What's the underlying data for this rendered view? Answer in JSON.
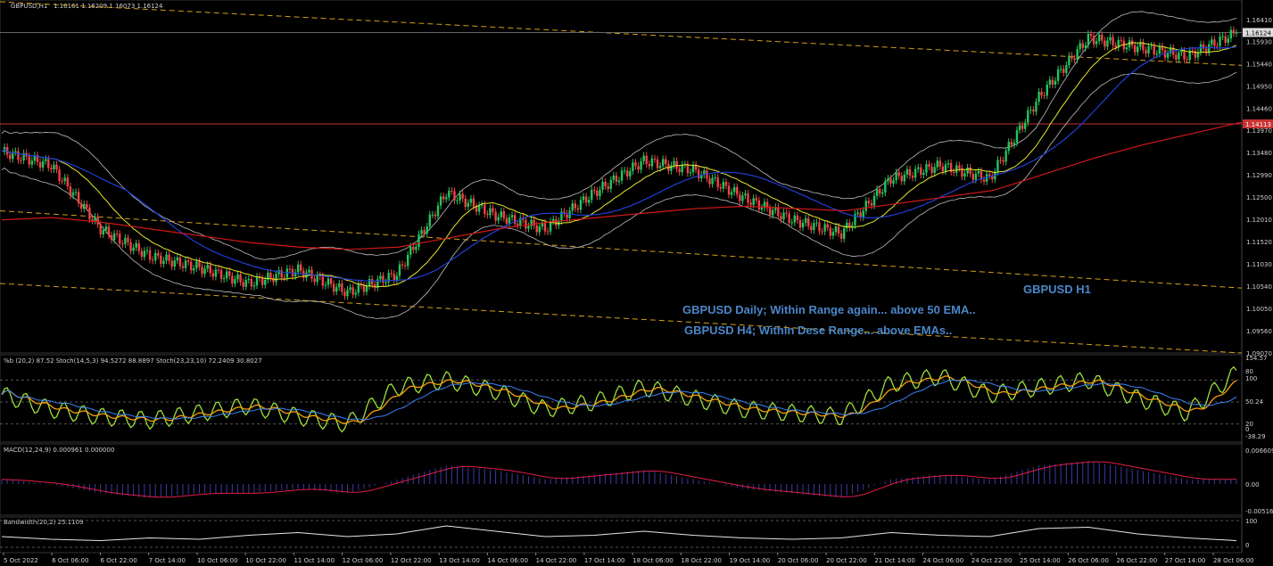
{
  "window": {
    "symbol_header": "GBPUSD,H1",
    "ohlc_header": "1.16161 1.16209 1.16073 1.16124"
  },
  "price_axis": {
    "ticks": [
      "1.16410",
      "1.15930",
      "1.15440",
      "1.14950",
      "1.14460",
      "1.13970",
      "1.13480",
      "1.12990",
      "1.12500",
      "1.12010",
      "1.11520",
      "1.11030",
      "1.10540",
      "1.10050",
      "1.09560",
      "1.09070"
    ],
    "current_price": "1.16124",
    "level_price": "1.14113"
  },
  "annotations": {
    "pair_tf": "GBPUSD H1",
    "daily_note": "GBPUSD Daily; Within Range again... above 50 EMA..",
    "h4_note": "GBPUSD H4;  Within Dese Range... above EMAs.."
  },
  "indicators": {
    "stoch": {
      "header": "%b (20,2) 87.52  Stoch(14,5,3) 94.5272 88.8897  Stoch(23,23,10) 72.2409 30.8027",
      "ticks": [
        "154.57",
        "80",
        "100",
        "50.24",
        "20",
        "0",
        "-38.29"
      ]
    },
    "macd": {
      "header": "MACD(12,24,9) 0.000961 0.000000",
      "ticks": [
        "0.006609",
        "0.00",
        "-0.005161"
      ]
    },
    "bandwidth": {
      "header": "Bandwidth(20,2) 25.1109",
      "ticks": [
        "100",
        "0"
      ]
    }
  },
  "time_axis": {
    "labels": [
      "5 Oct 2022",
      "6 Oct 06:00",
      "6 Oct 22:00",
      "7 Oct 14:00",
      "10 Oct 06:00",
      "10 Oct 22:00",
      "11 Oct 14:00",
      "12 Oct 06:00",
      "12 Oct 22:00",
      "13 Oct 14:00",
      "14 Oct 06:00",
      "14 Oct 22:00",
      "17 Oct 14:00",
      "18 Oct 06:00",
      "18 Oct 22:00",
      "19 Oct 14:00",
      "20 Oct 06:00",
      "20 Oct 22:00",
      "21 Oct 14:00",
      "24 Oct 06:00",
      "24 Oct 22:00",
      "25 Oct 14:00",
      "26 Oct 06:00",
      "26 Oct 22:00",
      "27 Oct 14:00",
      "28 Oct 06:00"
    ]
  },
  "colors": {
    "background": "#000000",
    "bull_candle": "#22c55e",
    "bear_candle": "#ef4444",
    "ema_fast": "#e6e62d",
    "ema_mid": "#1f3fd6",
    "ema_slow": "#d01818",
    "bollinger": "#bdbdbd",
    "channel": "#d4a017",
    "horizontal_level": "#c83232",
    "stoch_main": "#9be03a",
    "stoch_slow": "#f59e0b",
    "pctb": "#3b82f6",
    "macd_hist": "#3a3aa8",
    "macd_signal": "#e11d48"
  },
  "chart_data": {
    "type": "candlestick",
    "symbol": "GBPUSD",
    "timeframe": "H1",
    "x": [
      "5 Oct 2022",
      "6 Oct 06:00",
      "6 Oct 22:00",
      "7 Oct 14:00",
      "10 Oct 06:00",
      "10 Oct 22:00",
      "11 Oct 14:00",
      "12 Oct 06:00",
      "12 Oct 22:00",
      "13 Oct 14:00",
      "14 Oct 06:00",
      "14 Oct 22:00",
      "17 Oct 14:00",
      "18 Oct 06:00",
      "18 Oct 22:00",
      "19 Oct 14:00",
      "20 Oct 06:00",
      "20 Oct 22:00",
      "21 Oct 14:00",
      "24 Oct 06:00",
      "24 Oct 22:00",
      "25 Oct 14:00",
      "26 Oct 06:00",
      "26 Oct 22:00",
      "27 Oct 14:00",
      "28 Oct 06:00"
    ],
    "close": [
      1.135,
      1.132,
      1.118,
      1.112,
      1.1095,
      1.106,
      1.109,
      1.104,
      1.108,
      1.126,
      1.121,
      1.118,
      1.126,
      1.133,
      1.131,
      1.125,
      1.12,
      1.117,
      1.129,
      1.132,
      1.129,
      1.147,
      1.16,
      1.158,
      1.156,
      1.1612
    ],
    "ylim": [
      1.0907,
      1.168
    ],
    "ema_slow": [
      1.12,
      1.1205,
      1.1195,
      1.118,
      1.1165,
      1.115,
      1.114,
      1.1135,
      1.114,
      1.116,
      1.118,
      1.1195,
      1.1205,
      1.1215,
      1.1225,
      1.123,
      1.1225,
      1.122,
      1.1235,
      1.125,
      1.1265,
      1.13,
      1.1335,
      1.1365,
      1.139,
      1.1415
    ],
    "stoch_main": [
      60,
      40,
      30,
      25,
      35,
      45,
      30,
      20,
      70,
      80,
      65,
      40,
      50,
      70,
      55,
      40,
      35,
      30,
      75,
      85,
      60,
      70,
      80,
      55,
      35,
      90
    ],
    "macd": [
      0.001,
      0.0,
      -0.002,
      -0.003,
      -0.002,
      -0.002,
      -0.001,
      -0.002,
      0.001,
      0.004,
      0.003,
      0.001,
      0.002,
      0.003,
      0.001,
      -0.001,
      -0.002,
      -0.003,
      0.001,
      0.002,
      0.001,
      0.004,
      0.005,
      0.003,
      0.001,
      0.001
    ],
    "bandwidth": [
      40,
      30,
      25,
      35,
      30,
      45,
      55,
      40,
      50,
      80,
      60,
      40,
      45,
      60,
      45,
      35,
      30,
      35,
      55,
      45,
      40,
      70,
      75,
      50,
      35,
      25
    ]
  }
}
